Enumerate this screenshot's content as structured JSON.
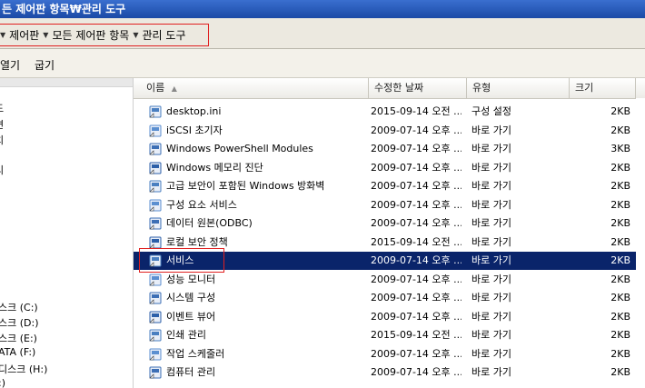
{
  "window": {
    "title": "든 제어판 항목₩관리 도구"
  },
  "address": {
    "breadcrumbs": [
      "제어판",
      "모든 제어판 항목",
      "관리 도구"
    ]
  },
  "toolbar": {
    "buttons": [
      "열기",
      "굽기"
    ]
  },
  "sidebar": {
    "items": [
      "드",
      "면",
      "치",
      "리",
      "스크 (C:)",
      "스크 (D:)",
      "스크 (E:)",
      "ATA (F:)",
      "디스크 (H:)",
      ":)"
    ]
  },
  "columns": {
    "name": "이름",
    "date": "수정한 날짜",
    "type": "유형",
    "size": "크기"
  },
  "files": [
    {
      "name": "desktop.ini",
      "date": "2015-09-14 오전 ...",
      "type": "구성 설정",
      "size": "2KB",
      "icon": "settings-file-icon"
    },
    {
      "name": "iSCSI 초기자",
      "date": "2009-07-14 오후 ...",
      "type": "바로 가기",
      "size": "2KB",
      "icon": "shortcut-icon"
    },
    {
      "name": "Windows PowerShell Modules",
      "date": "2009-07-14 오후 ...",
      "type": "바로 가기",
      "size": "3KB",
      "icon": "powershell-icon"
    },
    {
      "name": "Windows 메모리 진단",
      "date": "2009-07-14 오후 ...",
      "type": "바로 가기",
      "size": "2KB",
      "icon": "memory-diagnostic-icon"
    },
    {
      "name": "고급 보안이 포함된 Windows 방화벽",
      "date": "2009-07-14 오후 ...",
      "type": "바로 가기",
      "size": "2KB",
      "icon": "firewall-icon"
    },
    {
      "name": "구성 요소 서비스",
      "date": "2009-07-14 오후 ...",
      "type": "바로 가기",
      "size": "2KB",
      "icon": "component-services-icon"
    },
    {
      "name": "데이터 원본(ODBC)",
      "date": "2009-07-14 오후 ...",
      "type": "바로 가기",
      "size": "2KB",
      "icon": "odbc-icon"
    },
    {
      "name": "로컬 보안 정책",
      "date": "2015-09-14 오전 ...",
      "type": "바로 가기",
      "size": "2KB",
      "icon": "security-policy-icon"
    },
    {
      "name": "서비스",
      "date": "2009-07-14 오후 ...",
      "type": "바로 가기",
      "size": "2KB",
      "icon": "services-icon",
      "selected": true
    },
    {
      "name": "성능 모니터",
      "date": "2009-07-14 오후 ...",
      "type": "바로 가기",
      "size": "2KB",
      "icon": "performance-monitor-icon"
    },
    {
      "name": "시스템 구성",
      "date": "2009-07-14 오후 ...",
      "type": "바로 가기",
      "size": "2KB",
      "icon": "system-config-icon"
    },
    {
      "name": "이벤트 뷰어",
      "date": "2009-07-14 오후 ...",
      "type": "바로 가기",
      "size": "2KB",
      "icon": "event-viewer-icon"
    },
    {
      "name": "인쇄 관리",
      "date": "2015-09-14 오전 ...",
      "type": "바로 가기",
      "size": "2KB",
      "icon": "print-management-icon"
    },
    {
      "name": "작업 스케줄러",
      "date": "2009-07-14 오후 ...",
      "type": "바로 가기",
      "size": "2KB",
      "icon": "task-scheduler-icon"
    },
    {
      "name": "컴퓨터 관리",
      "date": "2009-07-14 오후 ...",
      "type": "바로 가기",
      "size": "2KB",
      "icon": "computer-management-icon"
    }
  ]
}
